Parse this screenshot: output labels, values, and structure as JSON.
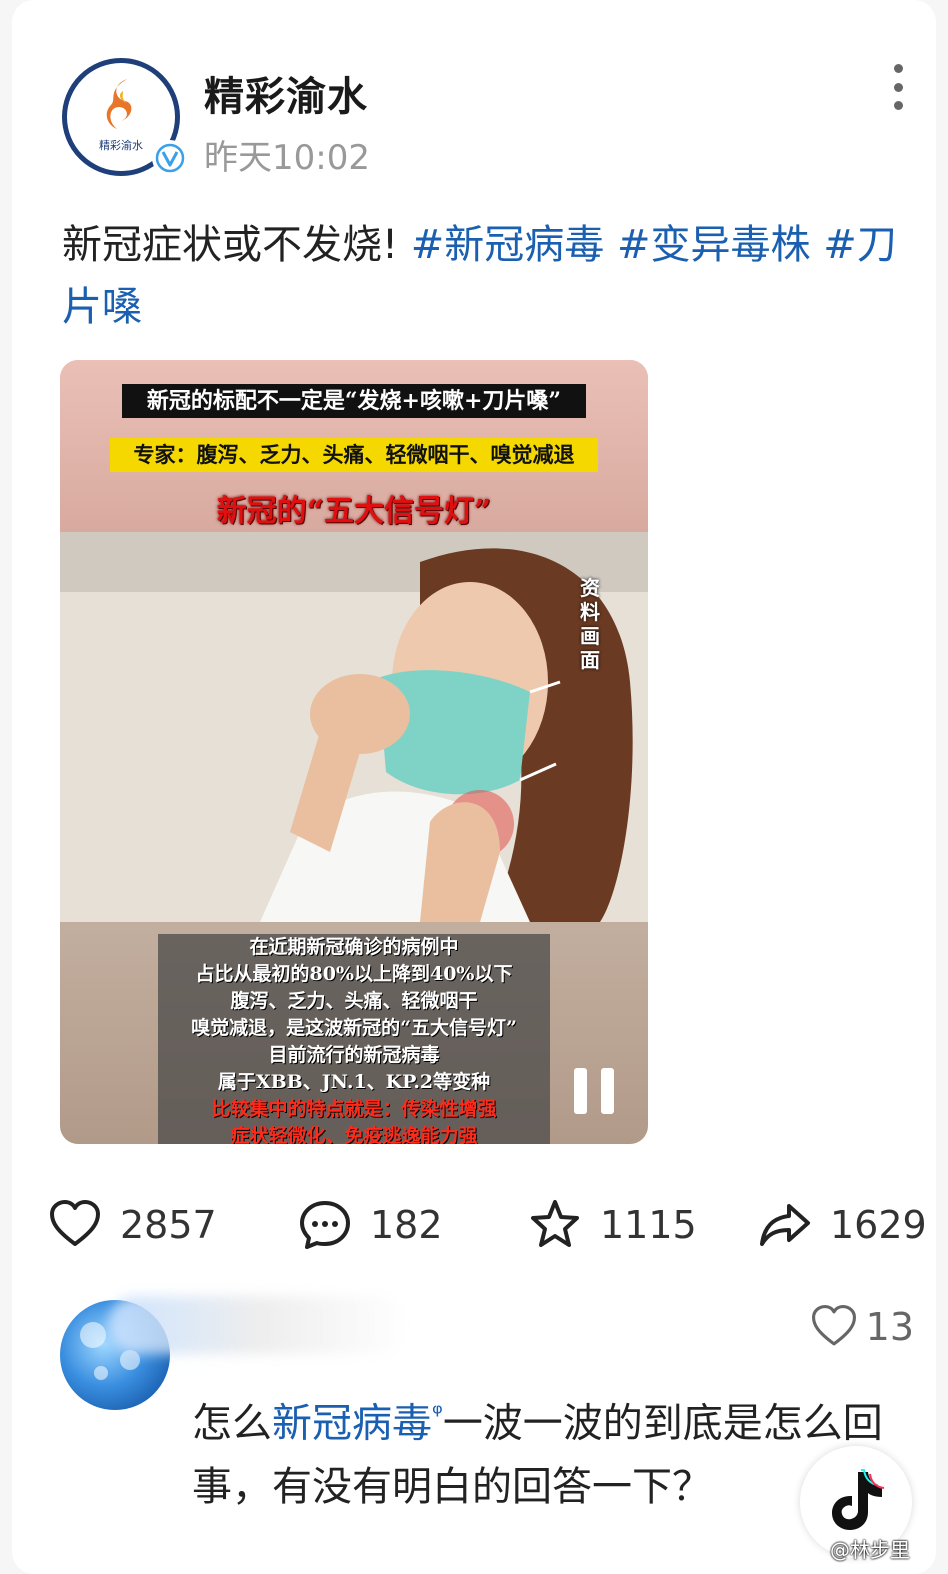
{
  "post": {
    "author": "精彩渝水",
    "time": "昨天10:02",
    "text": "新冠症状或不发烧!",
    "hashtags": [
      "#新冠病毒",
      "#变异毒株",
      "#刀片嗓"
    ],
    "avatar_text": "精彩渝水"
  },
  "video": {
    "banner1": "新冠的标配不一定是“发烧+咳嗽+刀片嗓”",
    "banner2": "专家：腹泻、乏力、头痛、轻微咽干、嗅觉减退",
    "banner3": "新冠的“五大信号灯”",
    "side_label": "资料画面",
    "captions": [
      "在近期新冠确诊的病例中",
      "占比从最初的80%以上降到40%以下",
      "腹泻、乏力、头痛、轻微咽干",
      "嗅觉减退，是这波新冠的“五大信号灯”",
      "目前流行的新冠病毒",
      "属于XBB、JN.1、KP.2等变种"
    ],
    "red_captions": [
      "比较集中的特点就是：传染性增强",
      "症状轻微化、免疫逃逸能力强"
    ],
    "state": "playing"
  },
  "actions": {
    "likes": "2857",
    "comments": "182",
    "favorites": "1115",
    "shares": "1629"
  },
  "comment": {
    "likes": "13",
    "text_before": "怎么",
    "link": "新冠病毒",
    "text_after": "一波一波的到底是怎么回事，有没有明白的回答一下？"
  },
  "watermark": {
    "text": "@林步里"
  },
  "colors": {
    "link": "#1a5fb0",
    "banner_yellow": "#f5d800",
    "banner_red": "#e01010"
  }
}
